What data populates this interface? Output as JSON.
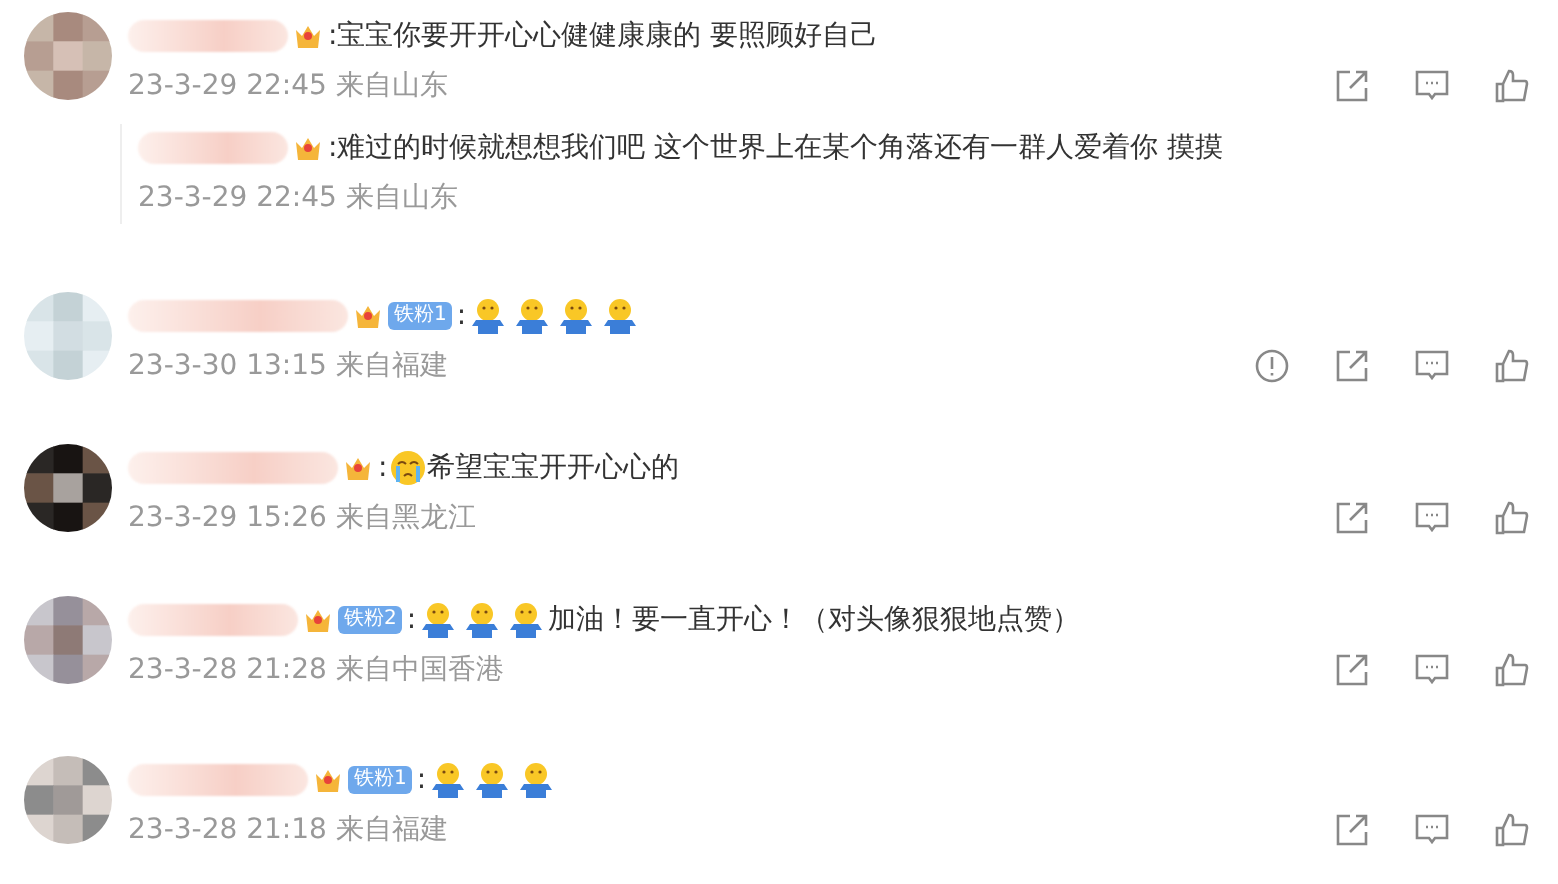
{
  "comments": [
    {
      "avatar": {
        "kind": "picture"
      },
      "content": [
        {
          "kind": "text",
          "text": ":宝宝你要开开心心健健康康的 要照顾好自己"
        }
      ],
      "time": "23-3-29 22:45",
      "location": "来自山东",
      "actions": [
        {
          "kind": "share"
        },
        {
          "kind": "reply"
        },
        {
          "kind": "like"
        }
      ],
      "replies": [
        {
          "content": [
            {
              "kind": "text",
              "text": ":难过的时候就想想我们吧 这个世界上在某个角落还有一群人爱着你 摸摸"
            }
          ],
          "time": "23-3-29 22:45",
          "location": "来自山东"
        }
      ]
    },
    {
      "avatar": {
        "kind": "picture"
      },
      "badge": "铁粉1",
      "content": [
        {
          "kind": "text",
          "text": ":"
        },
        {
          "kind": "hug"
        },
        {
          "kind": "hug"
        },
        {
          "kind": "hug"
        },
        {
          "kind": "hug"
        }
      ],
      "time": "23-3-30 13:15",
      "location": "来自福建",
      "actions": [
        {
          "kind": "report"
        },
        {
          "kind": "share"
        },
        {
          "kind": "reply"
        },
        {
          "kind": "like"
        }
      ]
    },
    {
      "avatar": {
        "kind": "picture"
      },
      "content": [
        {
          "kind": "text",
          "text": ":"
        },
        {
          "kind": "cry"
        },
        {
          "kind": "text",
          "text": "希望宝宝开开心心的"
        }
      ],
      "time": "23-3-29 15:26",
      "location": "来自黑龙江",
      "actions": [
        {
          "kind": "share"
        },
        {
          "kind": "reply"
        },
        {
          "kind": "like"
        }
      ]
    },
    {
      "avatar": {
        "kind": "picture"
      },
      "badge": "铁粉2",
      "content": [
        {
          "kind": "text",
          "text": ":"
        },
        {
          "kind": "hug"
        },
        {
          "kind": "hug"
        },
        {
          "kind": "hug"
        },
        {
          "kind": "text",
          "text": "加油！要一直开心！（对头像狠狠地点赞）"
        }
      ],
      "time": "23-3-28 21:28",
      "location": "来自中国香港",
      "actions": [
        {
          "kind": "share"
        },
        {
          "kind": "reply"
        },
        {
          "kind": "like"
        }
      ]
    },
    {
      "avatar": {
        "kind": "picture"
      },
      "badge": "铁粉1",
      "content": [
        {
          "kind": "text",
          "text": ":"
        },
        {
          "kind": "hug"
        },
        {
          "kind": "hug"
        },
        {
          "kind": "hug"
        }
      ],
      "time": "23-3-28 21:18",
      "location": "来自福建",
      "actions": [
        {
          "kind": "share"
        },
        {
          "kind": "reply"
        },
        {
          "kind": "like"
        }
      ]
    }
  ]
}
